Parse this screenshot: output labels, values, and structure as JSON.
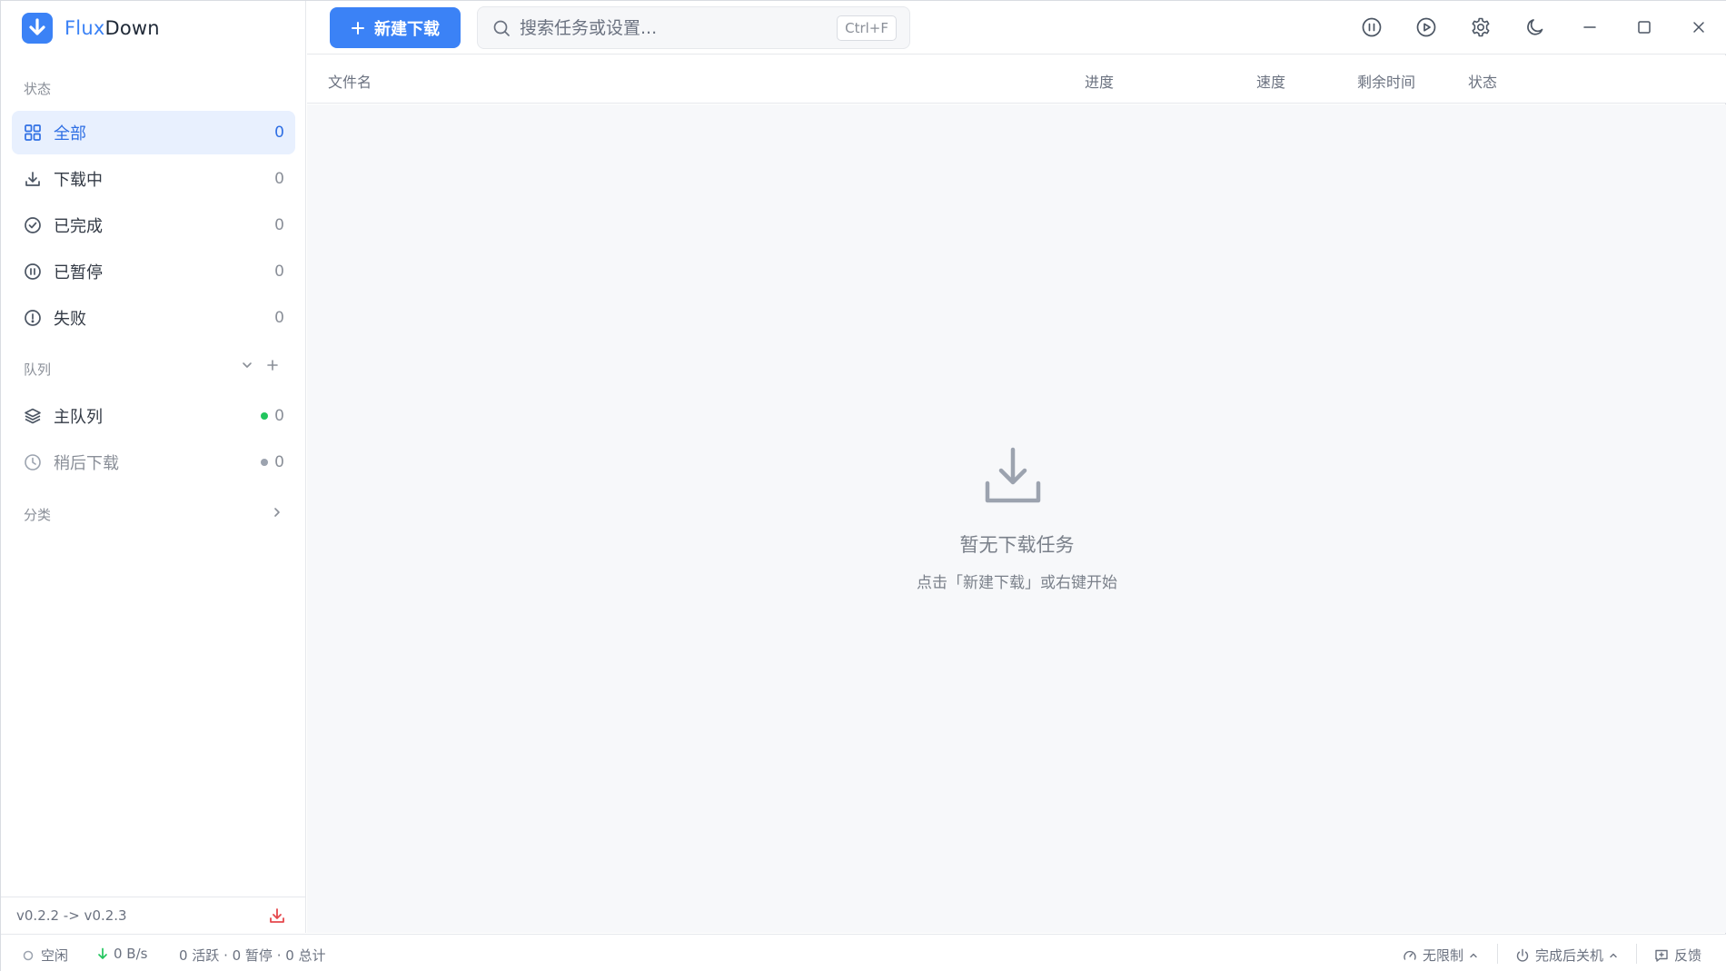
{
  "app": {
    "name_prefix": "Flux",
    "name_suffix": "Down",
    "accent": "#3b82f6"
  },
  "sidebar": {
    "status_title": "状态",
    "status_items": [
      {
        "label": "全部",
        "count": "0",
        "icon": "grid-icon",
        "active": true
      },
      {
        "label": "下载中",
        "count": "0",
        "icon": "download-icon"
      },
      {
        "label": "已完成",
        "count": "0",
        "icon": "check-circle-icon"
      },
      {
        "label": "已暂停",
        "count": "0",
        "icon": "pause-circle-icon"
      },
      {
        "label": "失败",
        "count": "0",
        "icon": "alert-circle-icon"
      }
    ],
    "queue_title": "队列",
    "queues": [
      {
        "label": "主队列",
        "count": "0",
        "icon": "layers-icon",
        "dot_color": "#22c55e"
      },
      {
        "label": "稍后下载",
        "count": "0",
        "icon": "clock-icon",
        "dot_color": "#9ca3af"
      }
    ],
    "category_title": "分类",
    "version": "v0.2.2 -> v0.2.3"
  },
  "toolbar": {
    "new_label": "新建下载",
    "search_placeholder": "搜索任务或设置...",
    "search_shortcut": "Ctrl+F"
  },
  "table": {
    "columns": {
      "filename": "文件名",
      "progress": "进度",
      "speed": "速度",
      "remaining": "剩余时间",
      "status": "状态"
    }
  },
  "empty_state": {
    "title": "暂无下载任务",
    "subtitle": "点击「新建下载」或右键开始"
  },
  "statusbar": {
    "state": "空闲",
    "speed": "0 B/s",
    "summary": "0 活跃 · 0 暂停 · 0 总计",
    "limit": "无限制",
    "after_complete": "完成后关机",
    "feedback": "反馈"
  }
}
